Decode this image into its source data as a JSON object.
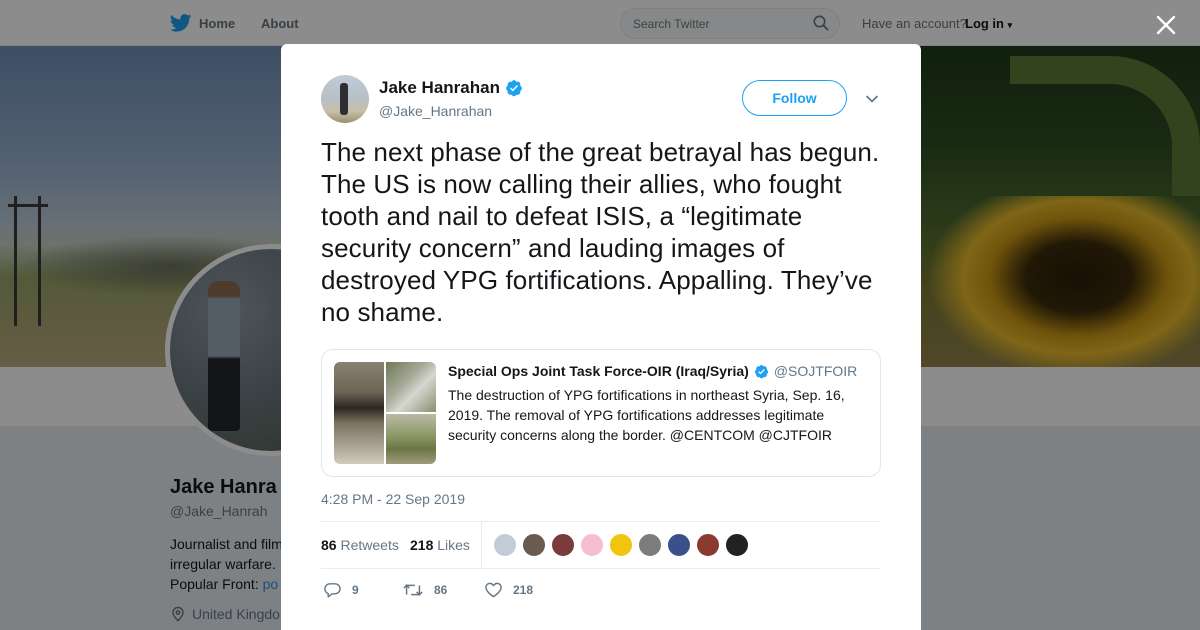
{
  "nav": {
    "home_label": "Home",
    "about_label": "About",
    "search_placeholder": "Search Twitter",
    "have_account": "Have an account?",
    "login_label": "Log in",
    "brand_color": "#1da1f2",
    "bird_icon": "twitter-bird-icon"
  },
  "profile": {
    "name": "Jake Hanra",
    "handle": "@Jake_Hanrah",
    "bio_line1": "Journalist and film",
    "bio_line2": "irregular warfare.",
    "bio_line3_prefix": "Popular Front:",
    "bio_line3_link": "po",
    "location": "United Kingdo"
  },
  "modal": {
    "author_name": "Jake Hanrahan",
    "author_handle": "@Jake_Hanrahan",
    "verified": true,
    "follow_label": "Follow",
    "tweet_text": "The next phase of the great betrayal has begun. The US is now calling their allies, who fought tooth and nail to defeat ISIS, a “legitimate security concern” and lauding images of destroyed YPG fortifications. Appalling. They’ve no shame.",
    "quote": {
      "name": "Special Ops Joint Task Force-OIR (Iraq/Syria)",
      "handle": "@SOJTFOIR",
      "text": "The destruction of YPG fortifications in northeast Syria, Sep. 16, 2019. The removal of YPG fortifications addresses legitimate security concerns along the border. @CENTCOM @CJTFOIR"
    },
    "timestamp": "4:28 PM - 22 Sep 2019",
    "stats": {
      "retweets_count": "86",
      "retweets_label": "Retweets",
      "likes_count": "218",
      "likes_label": "Likes"
    },
    "liker_colors": [
      "#c3ccd6",
      "#6b5a4e",
      "#7a3b3b",
      "#f4c0d0",
      "#f1c40f",
      "#7c7c7c",
      "#3b4f8a",
      "#8a3b30",
      "#222222"
    ],
    "actions": {
      "reply_count": "9",
      "retweet_count": "86",
      "like_count": "218"
    }
  }
}
